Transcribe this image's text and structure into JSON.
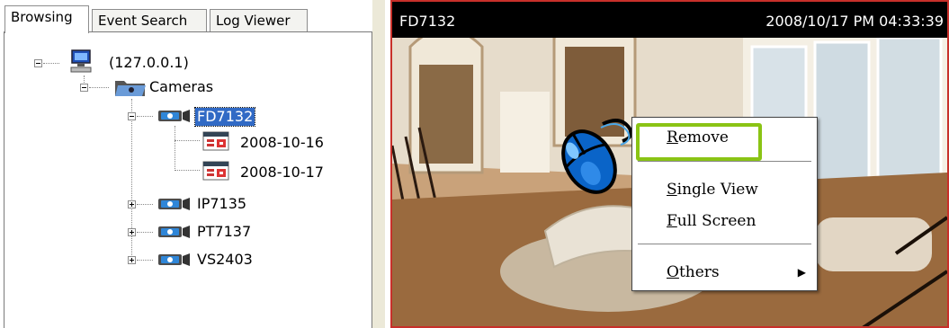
{
  "tabs": [
    {
      "label": "Browsing"
    },
    {
      "label": "Event Search"
    },
    {
      "label": "Log Viewer"
    }
  ],
  "tree": {
    "server": "(127.0.0.1)",
    "cameras": "Cameras",
    "items": [
      {
        "label": "FD7132",
        "dates": [
          "2008-10-16",
          "2008-10-17"
        ]
      },
      {
        "label": "IP7135"
      },
      {
        "label": "PT7137"
      },
      {
        "label": "VS2403"
      }
    ]
  },
  "video": {
    "camera": "FD7132",
    "timestamp": "2008/10/17 PM 04:33:39"
  },
  "context_menu": {
    "remove": {
      "hot": "R",
      "rest": "emove"
    },
    "single_view": {
      "hot": "S",
      "rest": "ingle View"
    },
    "full_screen": {
      "hot": "F",
      "rest": "ull Screen"
    },
    "others": {
      "hot": "O",
      "rest": "thers"
    }
  },
  "colors": {
    "selection": "#316ac5",
    "highlight": "#8ac414",
    "border": "#c8302a"
  }
}
